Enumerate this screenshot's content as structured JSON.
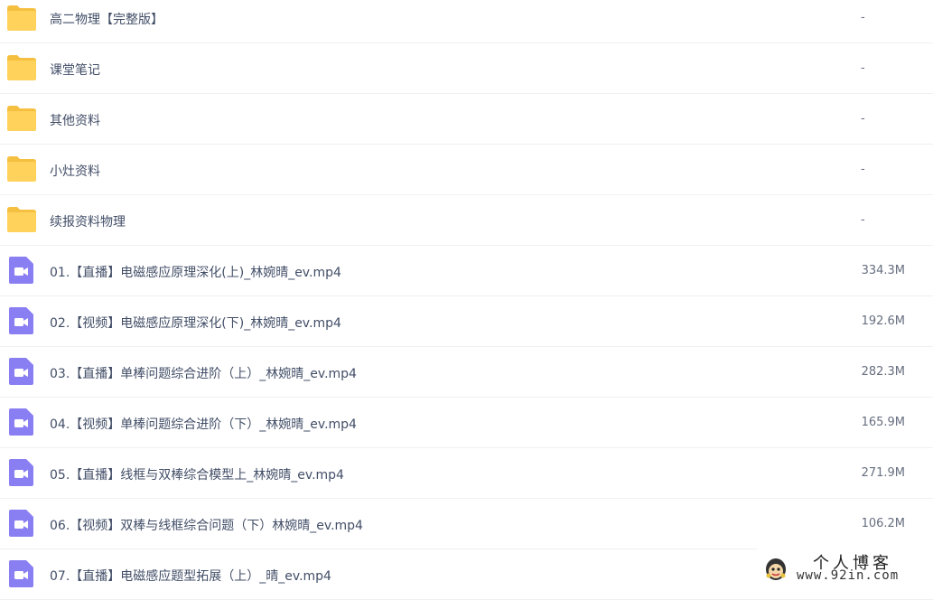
{
  "files": [
    {
      "name": "高二物理【完整版】",
      "size": "-",
      "type": "folder",
      "icon": "folder-icon"
    },
    {
      "name": "课堂笔记",
      "size": "-",
      "type": "folder",
      "icon": "folder-icon"
    },
    {
      "name": "其他资料",
      "size": "-",
      "type": "folder",
      "icon": "folder-icon"
    },
    {
      "name": "小灶资料",
      "size": "-",
      "type": "folder",
      "icon": "folder-icon"
    },
    {
      "name": "续报资料物理",
      "size": "-",
      "type": "folder",
      "icon": "folder-icon"
    },
    {
      "name": "01.【直播】电磁感应原理深化(上)_林婉晴_ev.mp4",
      "size": "334.3M",
      "type": "video",
      "icon": "video-file-icon"
    },
    {
      "name": "02.【视频】电磁感应原理深化(下)_林婉晴_ev.mp4",
      "size": "192.6M",
      "type": "video",
      "icon": "video-file-icon"
    },
    {
      "name": "03.【直播】单棒问题综合进阶（上）_林婉晴_ev.mp4",
      "size": "282.3M",
      "type": "video",
      "icon": "video-file-icon"
    },
    {
      "name": "04.【视频】单棒问题综合进阶（下）_林婉晴_ev.mp4",
      "size": "165.9M",
      "type": "video",
      "icon": "video-file-icon"
    },
    {
      "name": "05.【直播】线框与双棒综合模型上_林婉晴_ev.mp4",
      "size": "271.9M",
      "type": "video",
      "icon": "video-file-icon"
    },
    {
      "name": "06.【视频】双棒与线框综合问题（下）林婉晴_ev.mp4",
      "size": "106.2M",
      "type": "video",
      "icon": "video-file-icon"
    },
    {
      "name": "07.【直播】电磁感应题型拓展（上）_晴_ev.mp4",
      "size": "",
      "type": "video",
      "icon": "video-file-icon"
    }
  ],
  "watermark": {
    "title": "个人博客",
    "url": "www.92in.com"
  },
  "colors": {
    "folder": "#ffd25c",
    "folder_tab": "#f5c040",
    "video_icon": "#8a7ff2",
    "text": "#424e67",
    "size_text": "#666e7f",
    "divider": "#f0f0f0"
  }
}
